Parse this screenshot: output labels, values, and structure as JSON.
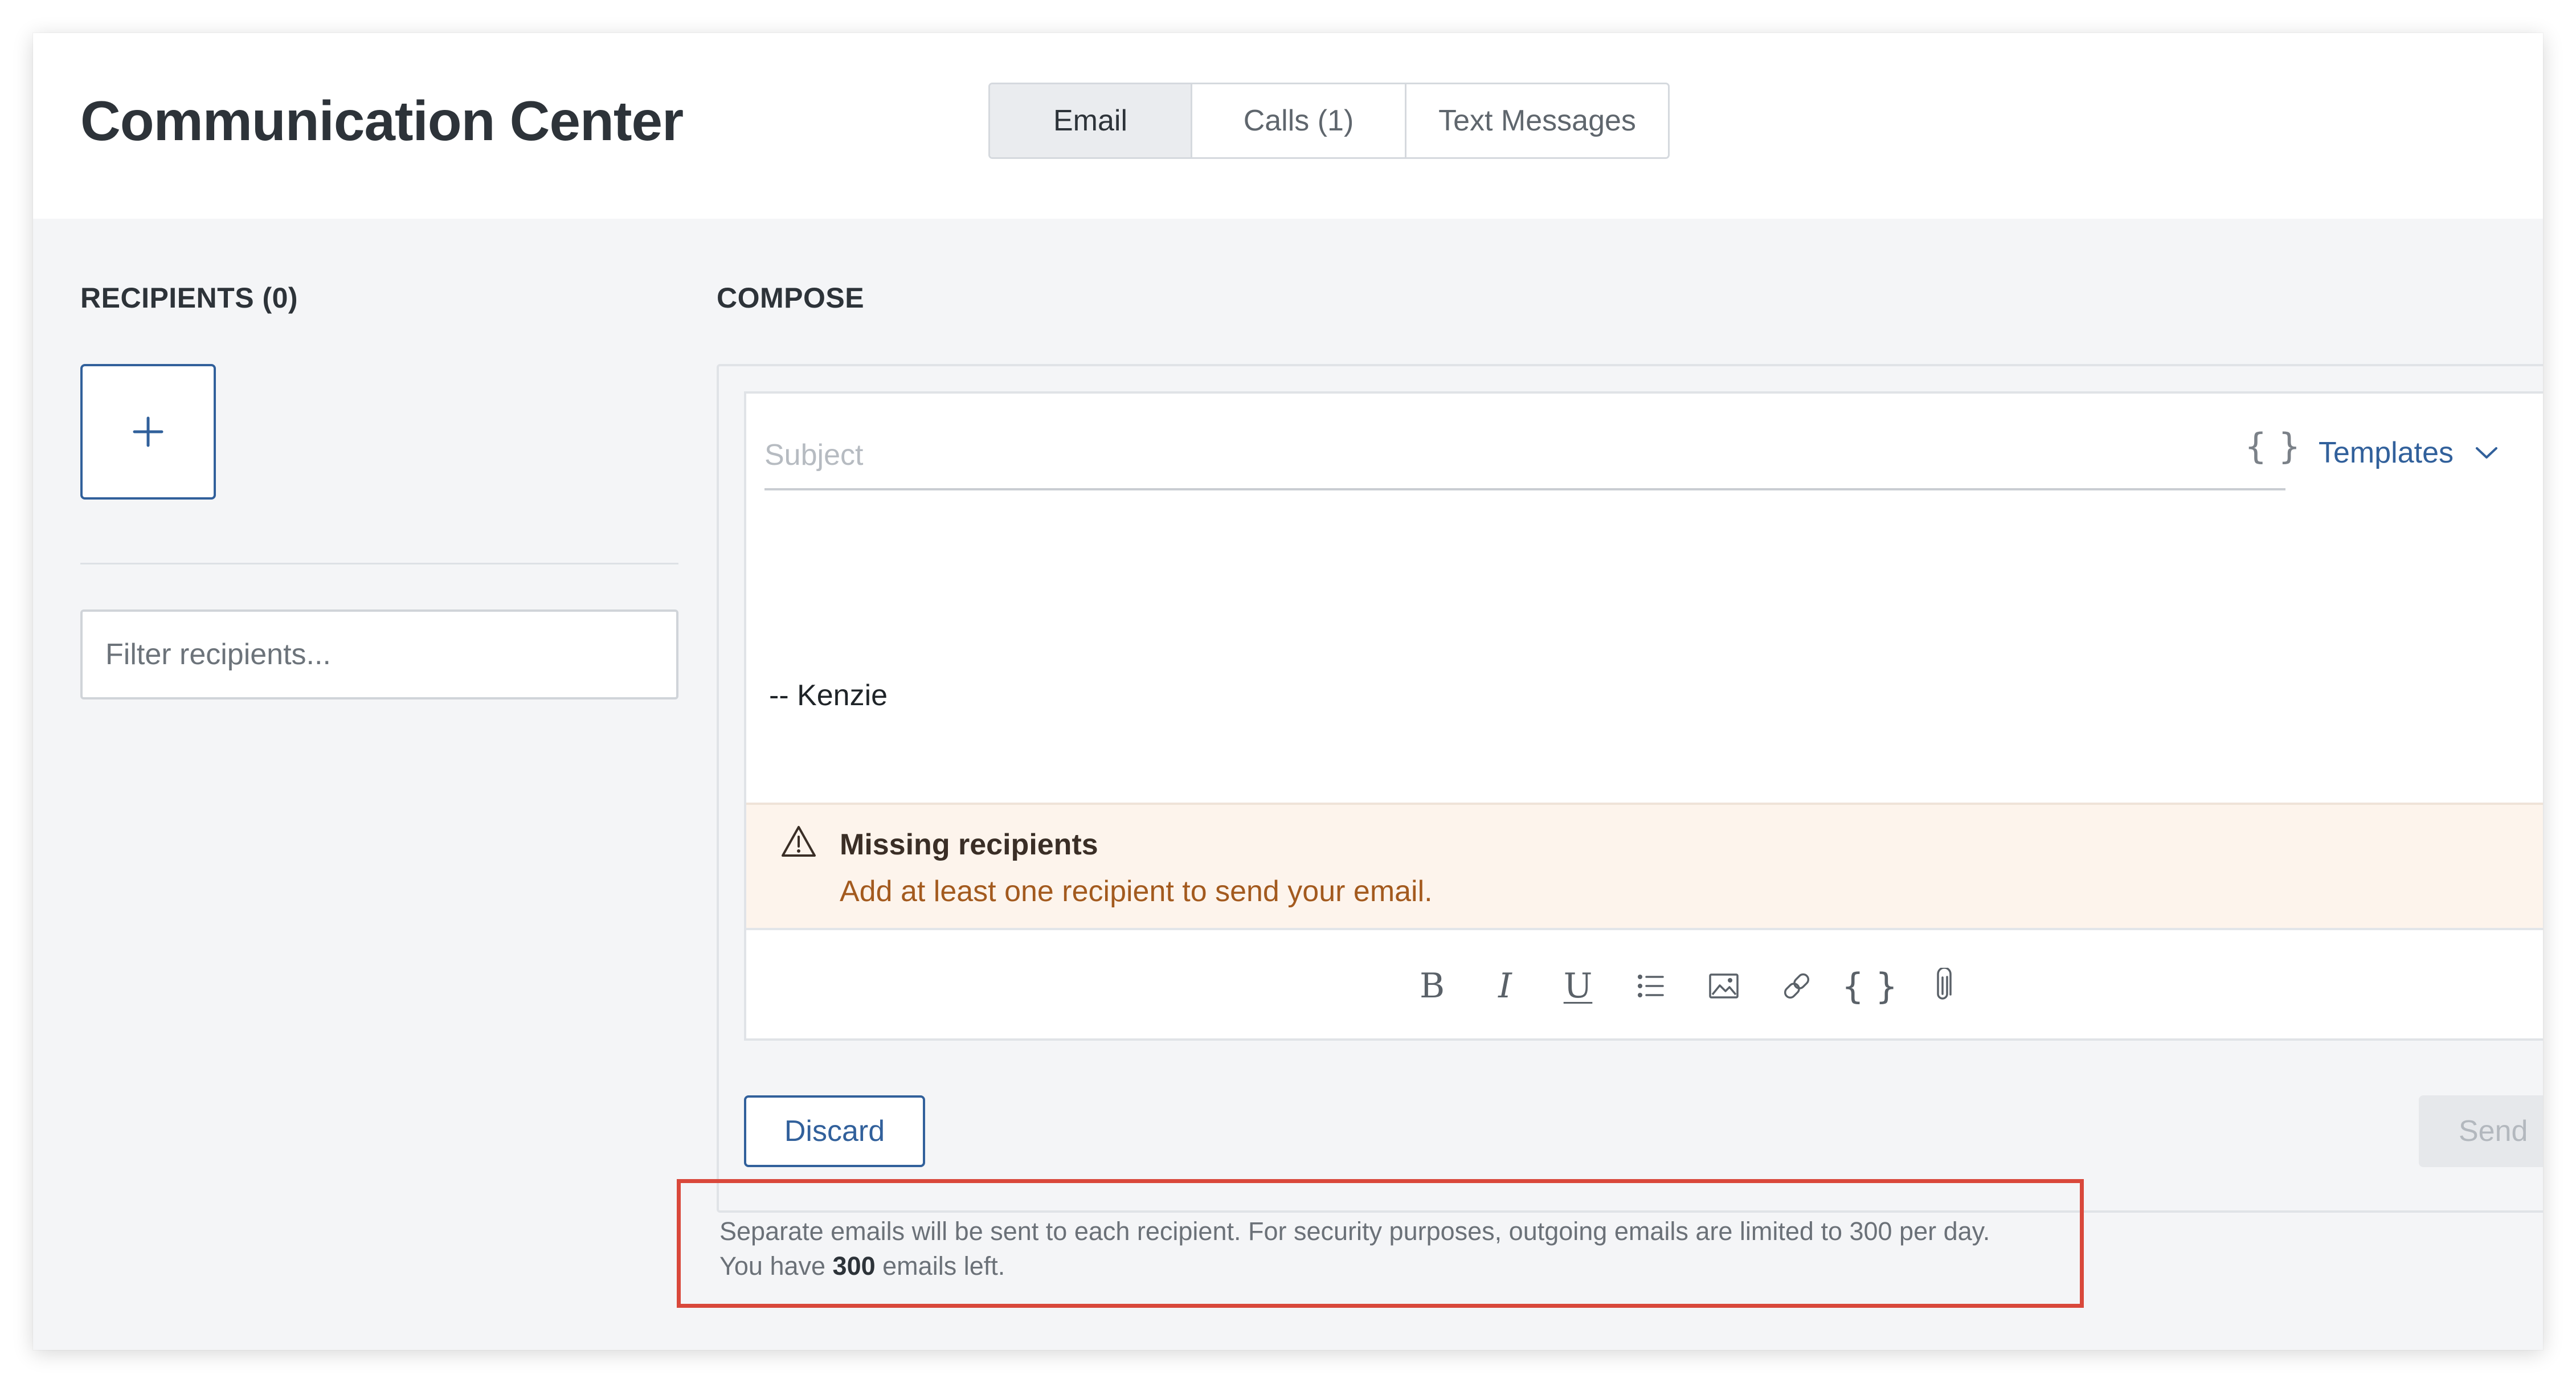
{
  "header": {
    "title": "Communication Center",
    "tabs": [
      {
        "label": "Email",
        "active": true
      },
      {
        "label": "Calls (1)",
        "active": false
      },
      {
        "label": "Text Messages",
        "active": false
      }
    ]
  },
  "recipients": {
    "heading": "RECIPIENTS (0)",
    "add_icon": "plus-icon",
    "filter_placeholder": "Filter recipients..."
  },
  "compose": {
    "heading": "COMPOSE",
    "subject_placeholder": "Subject",
    "subject_value": "",
    "variables_label": "{ }",
    "templates_label": "Templates",
    "templates_icon": "chevron-down-icon",
    "signature": "-- Kenzie",
    "alert": {
      "icon": "warning-triangle-icon",
      "title": "Missing recipients",
      "message": "Add at least one recipient to send your email."
    },
    "toolbar": {
      "bold": "B",
      "italic": "I",
      "underline": "U",
      "list_icon": "bulleted-list-icon",
      "image_icon": "image-icon",
      "link_icon": "link-icon",
      "variables": "{ }",
      "attach_icon": "paperclip-icon"
    },
    "discard_label": "Discard",
    "send_label": "Send"
  },
  "notice": {
    "line1": "Separate emails will be sent to each recipient. For security purposes, outgoing emails are limited to 300 per day.",
    "line2_prefix": "You have",
    "remaining": "300",
    "line2_suffix": "emails left."
  },
  "colors": {
    "accent": "#31609b",
    "alert_background": "#fdf4ec",
    "alert_text": "#a35a1e",
    "highlight_border": "#d9483b"
  }
}
